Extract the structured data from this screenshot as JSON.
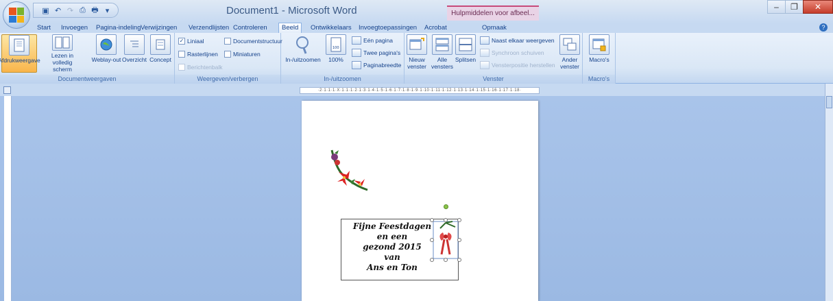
{
  "window": {
    "title": "Document1 - Microsoft Word",
    "context_tab": "Hulpmiddelen voor afbeel...",
    "controls": [
      "–",
      "❐",
      "✕"
    ]
  },
  "qat": {
    "icons": [
      "save-icon",
      "undo-icon",
      "redo-icon",
      "print-preview-icon",
      "print-icon",
      "dropdown-icon"
    ]
  },
  "tabs": [
    "Start",
    "Invoegen",
    "Pagina-indeling",
    "Verwijzingen",
    "Verzendlijsten",
    "Controleren",
    "Beeld",
    "Ontwikkelaars",
    "Invoegtoepassingen",
    "Acrobat",
    "Opmaak"
  ],
  "active_tab": "Beeld",
  "groups": {
    "documentweergaven": {
      "label": "Documentweergaven",
      "afdrukweergave": "Afdrukweergave",
      "lezen": "Lezen in volledig scherm",
      "weblay": "Weblay-out",
      "overzicht": "Overzicht",
      "concept": "Concept"
    },
    "weergeven": {
      "label": "Weergeven/verbergen",
      "liniaal": "Liniaal",
      "rasterlijnen": "Rasterlijnen",
      "berichtenbalk": "Berichtenbalk",
      "documentstructuur": "Documentstructuur",
      "miniaturen": "Miniaturen"
    },
    "zoom": {
      "label": "In-/uitzoomen",
      "inuit": "In-/uitzoomen",
      "honderd": "100%",
      "een_pagina": "Eén pagina",
      "twee_paginas": "Twee pagina's",
      "paginabreedte": "Paginabreedte"
    },
    "venster": {
      "label": "Venster",
      "nieuw": "Nieuw venster",
      "alle": "Alle vensters",
      "splitsen": "Splitsen",
      "naast_elkaar": "Naast elkaar weergeven",
      "synchroon": "Synchroon schuiven",
      "vensterpositie": "Vensterpositie herstellen",
      "ander": "Ander venster"
    },
    "macros": {
      "label": "Macro's",
      "macros": "Macro's"
    }
  },
  "ruler": {
    "marks": "·2·1·1·1·X·1·1·1·2·1·3·1·4·1·5·1·6·1·7·1·8·1·9·1·10·1·11·1·12·1·13·1·14·1·15·1·16·1·17·1·18·"
  },
  "card": {
    "lines": [
      "Fijne Feestdagen",
      "en een",
      "gezond 2015",
      "van",
      "Ans en Ton"
    ]
  },
  "colors": {
    "ribbon": "#dae7f6",
    "workspace": "#a9c4ea",
    "active_button": "#f9b54b",
    "close_button": "#c53c2a"
  }
}
